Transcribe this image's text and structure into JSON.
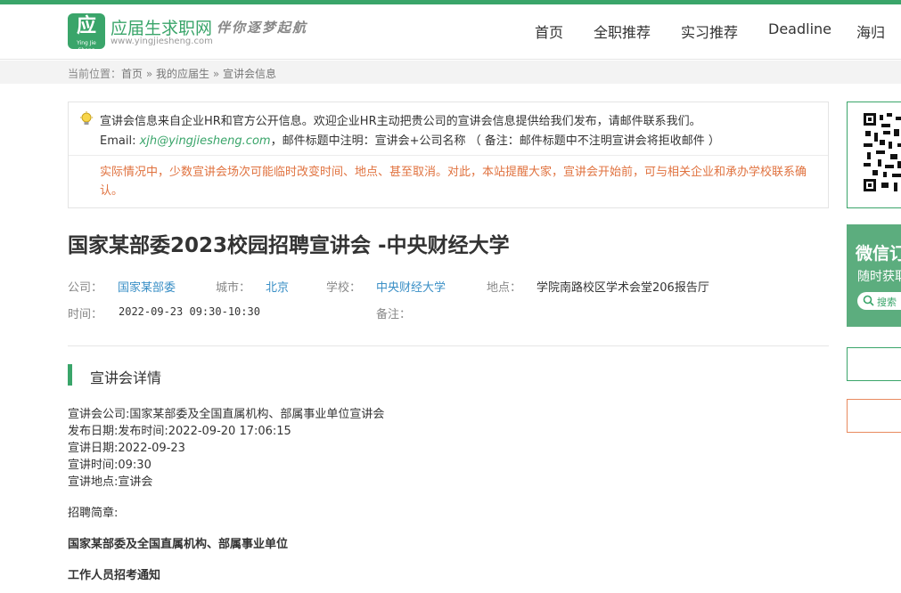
{
  "header": {
    "logo_glyph": "应",
    "logo_pinyin": "Ying Jie Sheng",
    "brand": "应届生求职网",
    "slogan": "伴你逐梦起航",
    "url": "www.yingjiesheng.com",
    "nav": [
      "首页",
      "全职推荐",
      "实习推荐",
      "Deadline",
      "海归"
    ]
  },
  "breadcrumb": {
    "prefix": "当前位置：",
    "items": [
      "首页",
      "我的应届生",
      "宣讲会信息"
    ],
    "sep": " » "
  },
  "notice": {
    "line1": "宣讲会信息来自企业HR和官方公开信息。欢迎企业HR主动把贵公司的宣讲会信息提供给我们发布，请邮件联系我们。",
    "email_label": "Email: ",
    "email": "xjh@yingjiesheng.com",
    "email_note": "，邮件标题中注明：宣讲会+公司名称 （ 备注：邮件标题中不注明宣讲会将拒收邮件 ）",
    "warning": "实际情况中，少数宣讲会场次可能临时改变时间、地点、甚至取消。对此，本站提醒大家，宣讲会开始前，可与相关企业和承办学校联系确认。"
  },
  "event": {
    "title": "国家某部委2023校园招聘宣讲会 -中央财经大学",
    "company_label": "公司：",
    "company": "国家某部委",
    "city_label": "城市：",
    "city": "北京",
    "school_label": "学校：",
    "school": "中央财经大学",
    "location_label": "地点：",
    "location": "学院南路校区学术会堂206报告厅",
    "time_label": "时间：",
    "time": "2022-09-23 09:30-10:30",
    "remark_label": "备注："
  },
  "details": {
    "section_title": "宣讲会详情",
    "lines": [
      "宣讲会公司:国家某部委及全国直属机构、部属事业单位宣讲会",
      "发布日期:发布时间:2022-09-20 17:06:15",
      "宣讲日期:2022-09-23",
      "宣讲时间:09:30",
      "宣讲地点:宣讲会"
    ],
    "recruit_label": "招聘简章:",
    "bold1": "国家某部委及全国直属机构、部属事业单位",
    "bold2": "工作人员招考通知"
  },
  "sidebar": {
    "wx_title": "微信订",
    "wx_sub": "随时获取",
    "wx_search": "搜索"
  }
}
